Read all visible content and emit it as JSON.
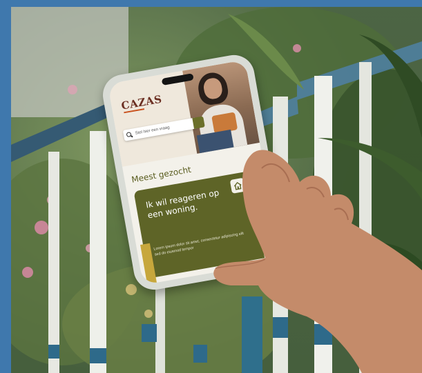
{
  "phone": {
    "brand": "CAZAS",
    "search_placeholder": "Stel hier een vraag",
    "section_title": "Meest gezocht",
    "card": {
      "title": "Ik wil reageren op een woning.",
      "body": "Lorem ipsum dolor sit amet, consectetur adipiscing elit sed do eiusmod tempor",
      "icon": "house-icon"
    }
  },
  "colors": {
    "border": "#3f78ad",
    "olive": "#5e6427",
    "mustard": "#c7a73c",
    "brand": "#6b2f22"
  }
}
